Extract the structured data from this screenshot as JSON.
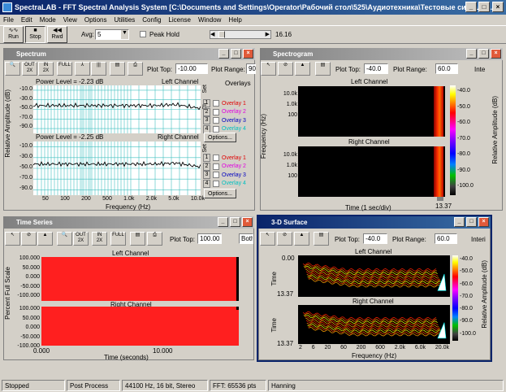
{
  "app": {
    "title": "SpectraLAB - FFT Spectral Analysis System [C:\\Documents and Settings\\Operator\\Рабочий стол\\525\\Аудиотехника\\Тестовые сигналы..."
  },
  "menu": [
    "File",
    "Edit",
    "Mode",
    "View",
    "Options",
    "Utilities",
    "Config",
    "License",
    "Window",
    "Help"
  ],
  "toolbar": {
    "run": "Run",
    "stop": "Stop",
    "rwd": "Rwd",
    "avg_label": "Avg:",
    "avg_value": "5",
    "peak_hold": "Peak Hold",
    "time_value": "16.16"
  },
  "spectrum": {
    "title": "Spectrum",
    "plot_top_label": "Plot Top:",
    "plot_top": "-10.00",
    "plot_range_label": "Plot Range:",
    "plot_range": "90",
    "top": {
      "power": "Power Level = -2.23 dB",
      "channel": "Left Channel"
    },
    "bottom": {
      "power": "Power Level = -2.25 dB",
      "channel": "Right Channel"
    },
    "y_ticks": [
      "-10.0",
      "-30.0",
      "-50.0",
      "-70.0",
      "-90.0"
    ],
    "x_ticks": [
      "50",
      "100",
      "200",
      "500",
      "1.0k",
      "2.0k",
      "5.0k",
      "10.0k"
    ],
    "xlabel": "Frequency (Hz)",
    "ylabel": "Relative Amplitude (dB)",
    "overlays_label": "Overlays",
    "set_label": "Set",
    "clr_label": "Clr",
    "options": "Options...",
    "overlays": [
      {
        "n": "1",
        "label": "Overlay 1",
        "color": "#e00000"
      },
      {
        "n": "2",
        "label": "Overlay 2",
        "color": "#e000e0"
      },
      {
        "n": "3",
        "label": "Overlay 3",
        "color": "#0000c0"
      },
      {
        "n": "4",
        "label": "Overlay 4",
        "color": "#00c0c0"
      }
    ]
  },
  "spectrogram": {
    "title": "Spectrogram",
    "plot_top_label": "Plot Top:",
    "plot_top": "-40.0",
    "plot_range_label": "Plot Range:",
    "plot_range": "60.0",
    "cut": "Inte",
    "left": "Left Channel",
    "right": "Right Channel",
    "y_ticks": [
      "10.0k",
      "1.0k",
      "100"
    ],
    "ylabel": "Frequency (Hz)",
    "xlabel": "Time (1 sec/div)",
    "x_end": "13.37",
    "cbar_ticks": [
      "-40.0",
      "-50.0",
      "-60.0",
      "-70.0",
      "-80.0",
      "-90.0",
      "-100.0"
    ],
    "cbar_label": "Relative Amplitude (dB)"
  },
  "timeseries": {
    "title": "Time Series",
    "plot_top_label": "Plot Top:",
    "plot_top": "100.00",
    "both": "Both",
    "left": "Left Channel",
    "right": "Right Channel",
    "y_ticks": [
      "100.000",
      "50.000",
      "0.000",
      "-50.000",
      "-100.000"
    ],
    "ylabel": "Percent Full Scale",
    "x_ticks": [
      "0.000",
      "10.000"
    ],
    "xlabel": "Time (seconds)"
  },
  "surface": {
    "title": "3-D Surface",
    "plot_top_label": "Plot Top:",
    "plot_top": "-40.0",
    "plot_range_label": "Plot Range:",
    "plot_range": "60.0",
    "cut": "Interi",
    "left": "Left Channel",
    "right": "Right Channel",
    "t0": "0.00",
    "t1": "13.37",
    "ylabel": "Time",
    "x_ticks": [
      "2",
      "6",
      "20",
      "60",
      "200",
      "600",
      "2.0k",
      "6.0k",
      "20.0k"
    ],
    "xlabel": "Frequency (Hz)",
    "cbar_ticks": [
      "-40.0",
      "-50.0",
      "-60.0",
      "-70.0",
      "-80.0",
      "-90.0",
      "-100.0"
    ],
    "cbar_label": "Relative Amplitude (dB)"
  },
  "status": [
    "Stopped",
    "Post Process",
    "44100 Hz, 16 bit, Stereo",
    "FFT: 65536 pts",
    "Hanning"
  ]
}
